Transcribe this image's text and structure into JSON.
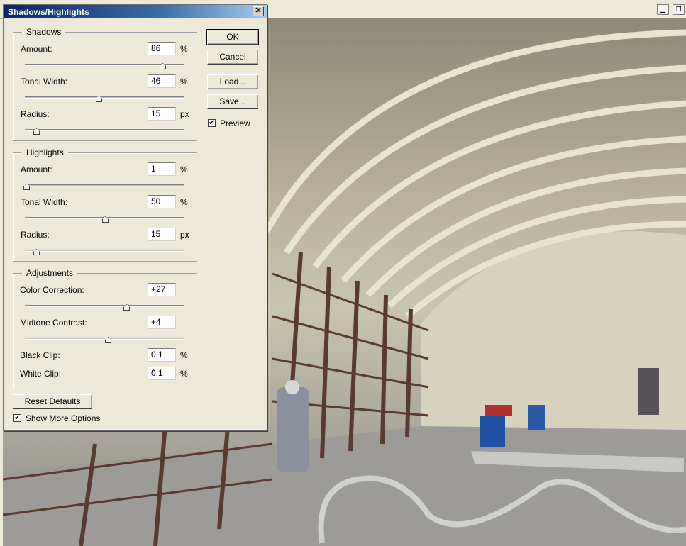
{
  "dialog": {
    "title": "Shadows/Highlights",
    "close_glyph": "✕"
  },
  "shadows": {
    "legend": "Shadows",
    "amount": {
      "label": "Amount:",
      "value": "86",
      "unit": "%",
      "slider": 0.86
    },
    "tonal_width": {
      "label": "Tonal Width:",
      "value": "46",
      "unit": "%",
      "slider": 0.46
    },
    "radius": {
      "label": "Radius:",
      "value": "15",
      "unit": "px",
      "slider": 0.07
    }
  },
  "highlights": {
    "legend": "Highlights",
    "amount": {
      "label": "Amount:",
      "value": "1",
      "unit": "%",
      "slider": 0.01
    },
    "tonal_width": {
      "label": "Tonal Width:",
      "value": "50",
      "unit": "%",
      "slider": 0.5
    },
    "radius": {
      "label": "Radius:",
      "value": "15",
      "unit": "px",
      "slider": 0.07
    }
  },
  "adjustments": {
    "legend": "Adjustments",
    "color_correction": {
      "label": "Color Correction:",
      "value": "+27",
      "slider": 0.635
    },
    "midtone_contrast": {
      "label": "Midtone Contrast:",
      "value": "+4",
      "slider": 0.52
    },
    "black_clip": {
      "label": "Black Clip:",
      "value": "0,1",
      "unit": "%"
    },
    "white_clip": {
      "label": "White Clip:",
      "value": "0,1",
      "unit": "%"
    }
  },
  "buttons": {
    "ok": "OK",
    "cancel": "Cancel",
    "load": "Load...",
    "save": "Save...",
    "reset_defaults": "Reset Defaults"
  },
  "checkboxes": {
    "preview": {
      "label": "Preview",
      "checked": true
    },
    "show_more": {
      "label": "Show More Options",
      "checked": true
    }
  },
  "check_glyph": "✔",
  "image_window": {
    "minimize_glyph": "▁",
    "maximize_glyph": "❐"
  }
}
